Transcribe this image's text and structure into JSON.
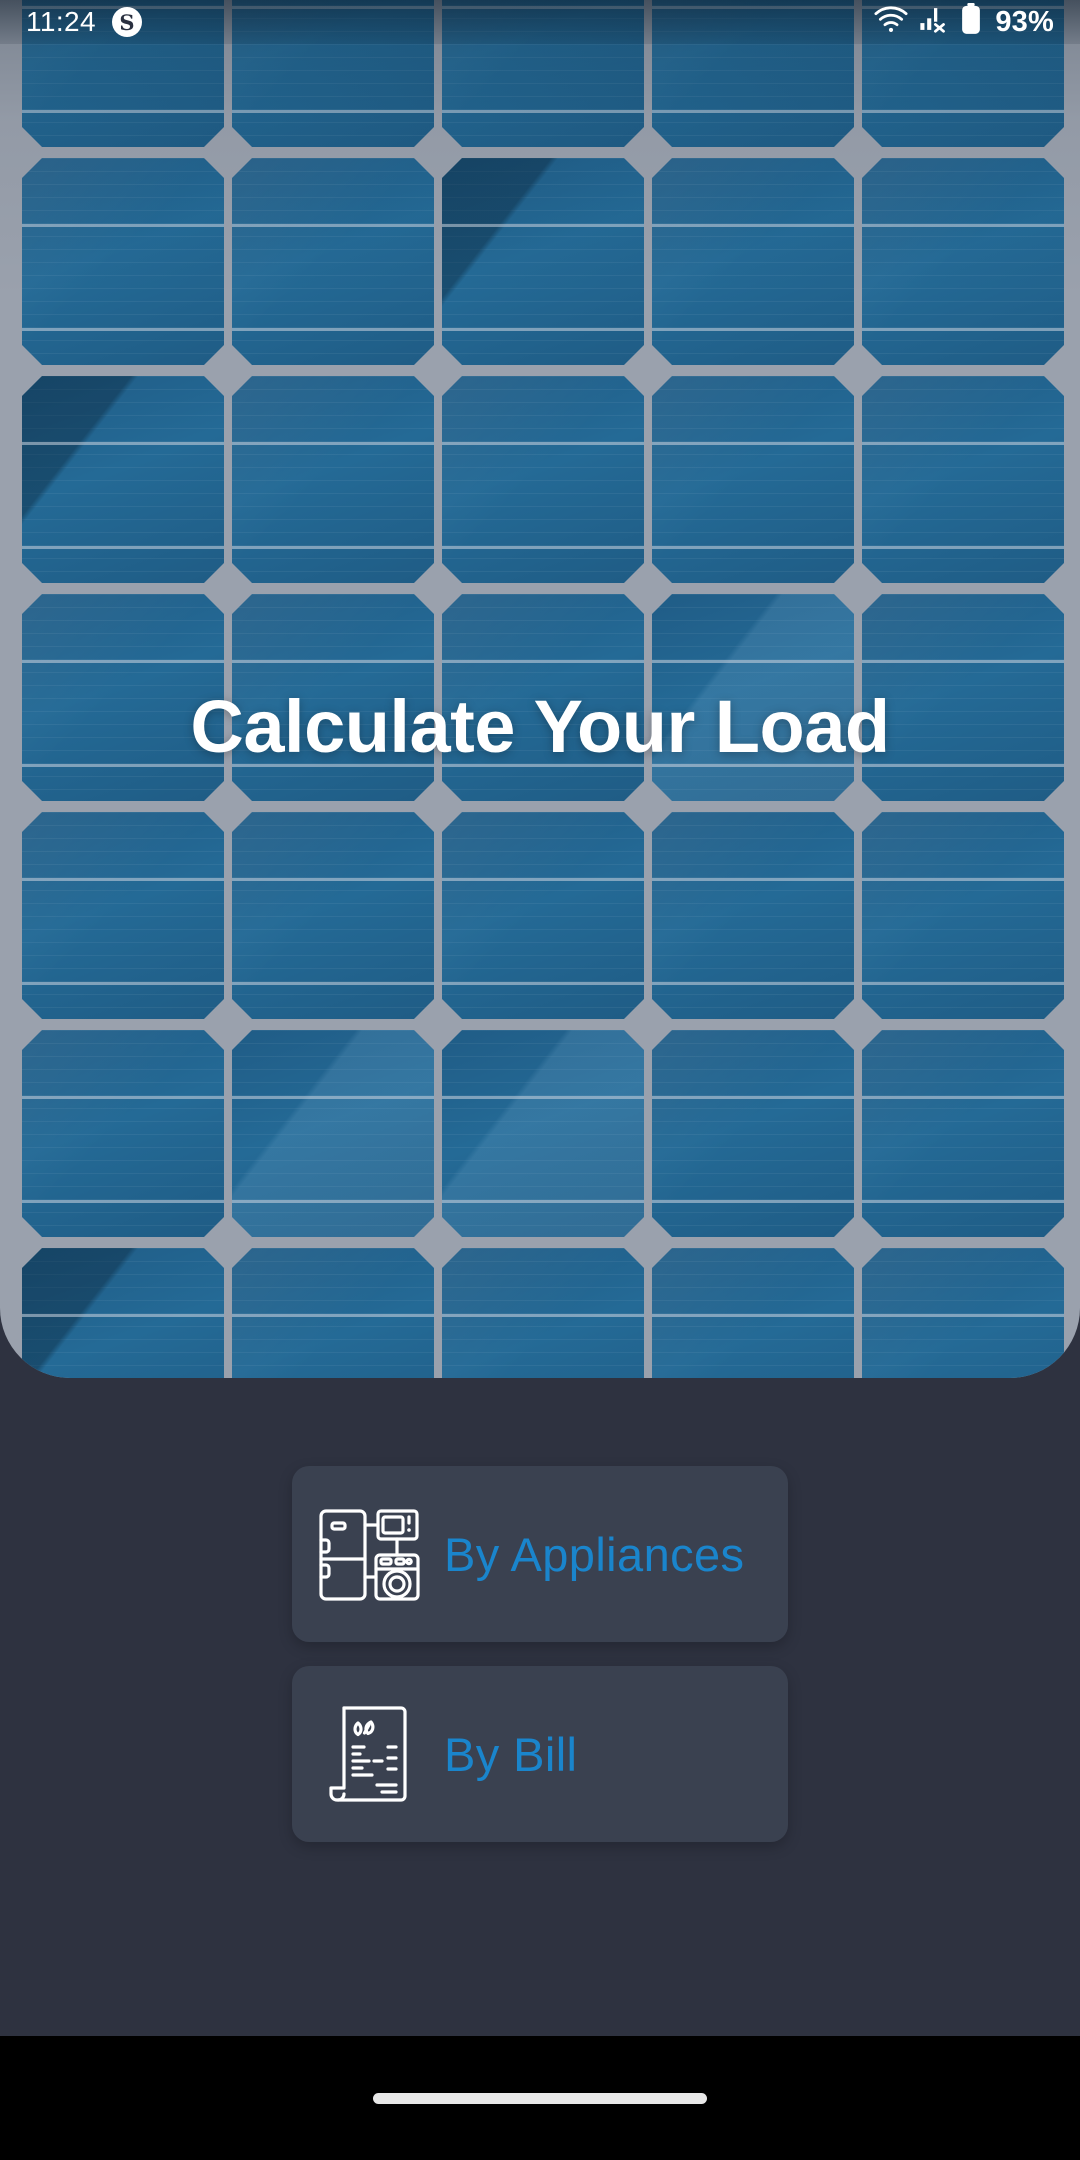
{
  "statusbar": {
    "time": "11:24",
    "notification_badge": "S",
    "notification_badge_name": "skype-notification-icon",
    "wifi_icon": "wifi-icon",
    "cellular_icon": "cellular-no-service-icon",
    "battery_icon": "battery-icon",
    "battery_percent": "93%"
  },
  "hero": {
    "title": "Calculate Your Load",
    "background_image": "solar-panel-photo",
    "panel_cell_columns": 5,
    "panel_cell_rows": 7,
    "colors": {
      "cell_blue": "#246a96",
      "frame_gray": "#9aa1ad"
    }
  },
  "actions": {
    "items": [
      {
        "label": "By Appliances",
        "icon": "appliances-icon",
        "name": "by-appliances-button"
      },
      {
        "label": "By Bill",
        "icon": "bill-icon",
        "name": "by-bill-button"
      }
    ],
    "colors": {
      "card_bg": "#3a4150",
      "label": "#1a85cc"
    }
  },
  "navbar": {
    "home_indicator": "home-indicator-pill"
  },
  "page": {
    "background": "#2e3240"
  }
}
